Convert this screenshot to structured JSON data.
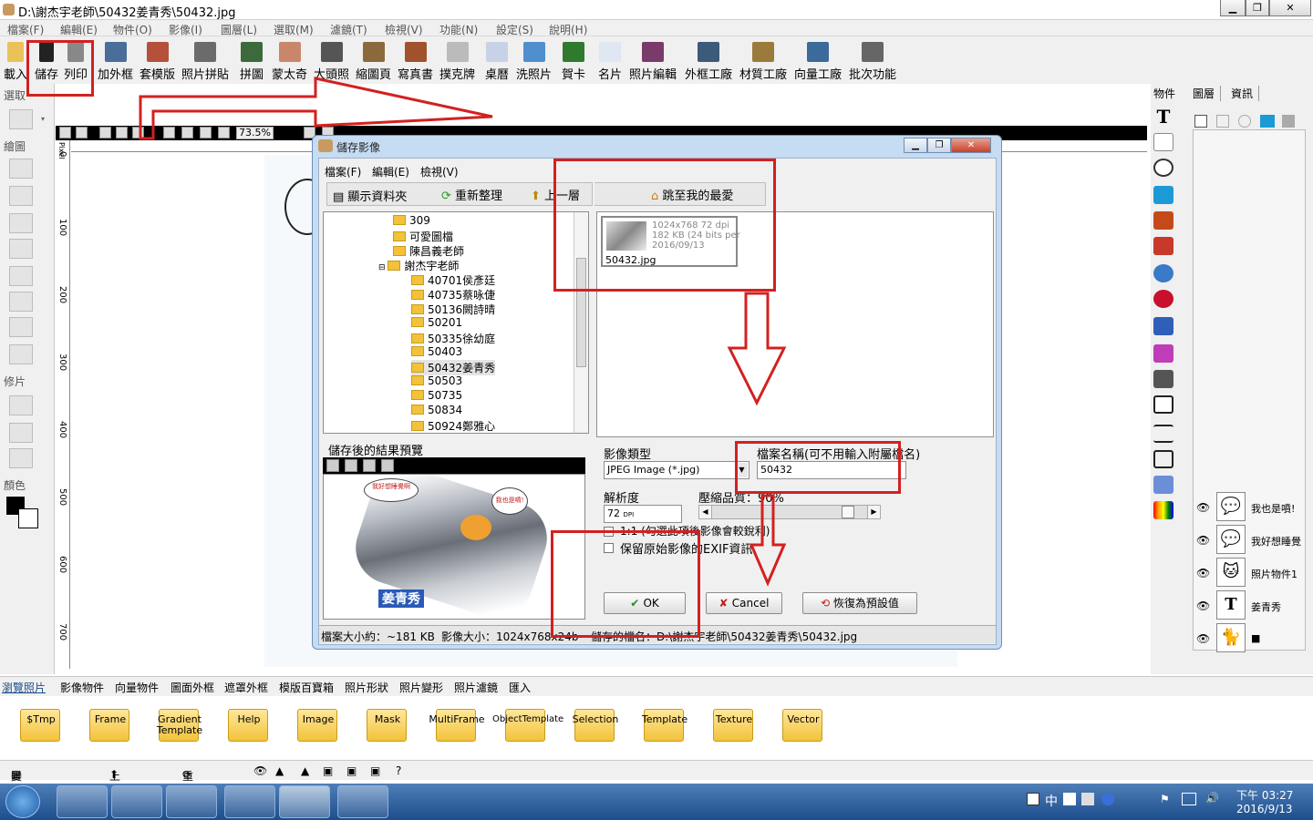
{
  "window": {
    "title": "D:\\謝杰宇老師\\50432姜青秀\\50432.jpg",
    "btn_min": "▁",
    "btn_max": "❐",
    "btn_close": "✕"
  },
  "menu": [
    "檔案(F)",
    "編輯(E)",
    "物件(O)",
    "影像(I)",
    "圖層(L)",
    "選取(M)",
    "濾鏡(T)",
    "檢視(V)",
    "功能(N)",
    "設定(S)",
    "說明(H)"
  ],
  "toolbar": [
    "載入",
    "儲存",
    "列印",
    "加外框",
    "套模版",
    "照片拼貼",
    "拼圖",
    "蒙太奇",
    "大頭照",
    "縮圖頁",
    "寫真書",
    "撲克牌",
    "桌曆",
    "洗照片",
    "賀卡",
    "名片",
    "照片編輯",
    "外框工廠",
    "材質工廠",
    "向量工廠",
    "批次功能"
  ],
  "left_panel": {
    "select": "選取",
    "draw": "繪圖",
    "retouch": "修片",
    "color": "顏色"
  },
  "view": {
    "zoom": "73.5%",
    "ruler_unit": "Pixel",
    "ruler_marks": [
      "0",
      "100",
      "200",
      "300",
      "400",
      "500",
      "600",
      "700"
    ]
  },
  "right_panel": {
    "objects_label": "物件",
    "tab_layers": "圖層",
    "tab_info": "資訊"
  },
  "layers": [
    {
      "name": "我也是噴!",
      "thumb": "💬"
    },
    {
      "name": "我好想睡覺",
      "thumb": "💬"
    },
    {
      "name": "照片物件1",
      "thumb": "🐱"
    },
    {
      "name": "姜青秀",
      "thumb": "T"
    },
    {
      "name": "",
      "thumb": "🐈"
    }
  ],
  "dialog": {
    "title": "儲存影像",
    "menu": [
      "檔案(F)",
      "編輯(E)",
      "檢視(V)"
    ],
    "show_folder": "顯示資料夾",
    "refresh": "重新整理",
    "up": "上一層",
    "favorites": "跳至我的最愛",
    "tree": [
      "309",
      "可愛圖檔",
      "陳昌義老師",
      "謝杰宇老師",
      "40701侯彥廷",
      "40735蔡咏倢",
      "50136闕詩晴",
      "50201",
      "50335徐幼庭",
      "50403",
      "50432姜青秀",
      "50503",
      "50735",
      "50834",
      "50924鄭雅心"
    ],
    "file": {
      "info1": "1024x768 72 dpi",
      "info2": "182 KB (24 bits per",
      "info3": "2016/09/13",
      "name": "50432.jpg"
    },
    "preview_label": "儲存後的結果預覽",
    "preview_caption": "姜青秀",
    "bubble1": "我好想睡覺啊",
    "bubble2": "我也是噴!",
    "image_type_label": "影像類型",
    "image_type_value": "JPEG Image (*.jpg)",
    "filename_label": "檔案名稱(可不用輸入附屬檔名)",
    "filename_value": "50432",
    "resolution_label": "解析度",
    "resolution_value": "72",
    "resolution_unit": "DPI",
    "quality_label": "壓縮品質：90%",
    "quality": 0.9,
    "chk1": "1:1 (勾選此項後影像會較銳利)",
    "chk2": "保留原始影像的EXIF資訊",
    "ok": "OK",
    "cancel": "Cancel",
    "reset": "恢復為預設值",
    "status_size": "檔案大小約：~181 KB",
    "status_dims": "影像大小：1024x768x24b",
    "status_path": "儲存的檔名：D:\\謝杰宇老師\\50432姜青秀\\50432.jpg"
  },
  "bottom_tabs": [
    "瀏覽照片",
    "影像物件",
    "向量物件",
    "圖面外框",
    "遮罩外框",
    "模版百寶箱",
    "照片形狀",
    "照片變形",
    "照片濾鏡",
    "匯入"
  ],
  "folders": [
    "$Tmp",
    "Frame",
    "Gradient Template",
    "Help",
    "Image",
    "Mask",
    "MultiFrame",
    "ObjectTemplate",
    "Selection",
    "Template",
    "Texture",
    "Vector"
  ],
  "browse_bar": {
    "change_folder": "變更資料夾",
    "up": "上一層",
    "refresh": "重新整理",
    "help": "?"
  },
  "taskbar": {
    "ime": "中",
    "time": "下午 03:27",
    "date": "2016/9/13"
  },
  "colors": {
    "annotation_red": "#d42020",
    "taskbar": "#1c4d8c",
    "dialog_frame": "#c6dcf3"
  }
}
